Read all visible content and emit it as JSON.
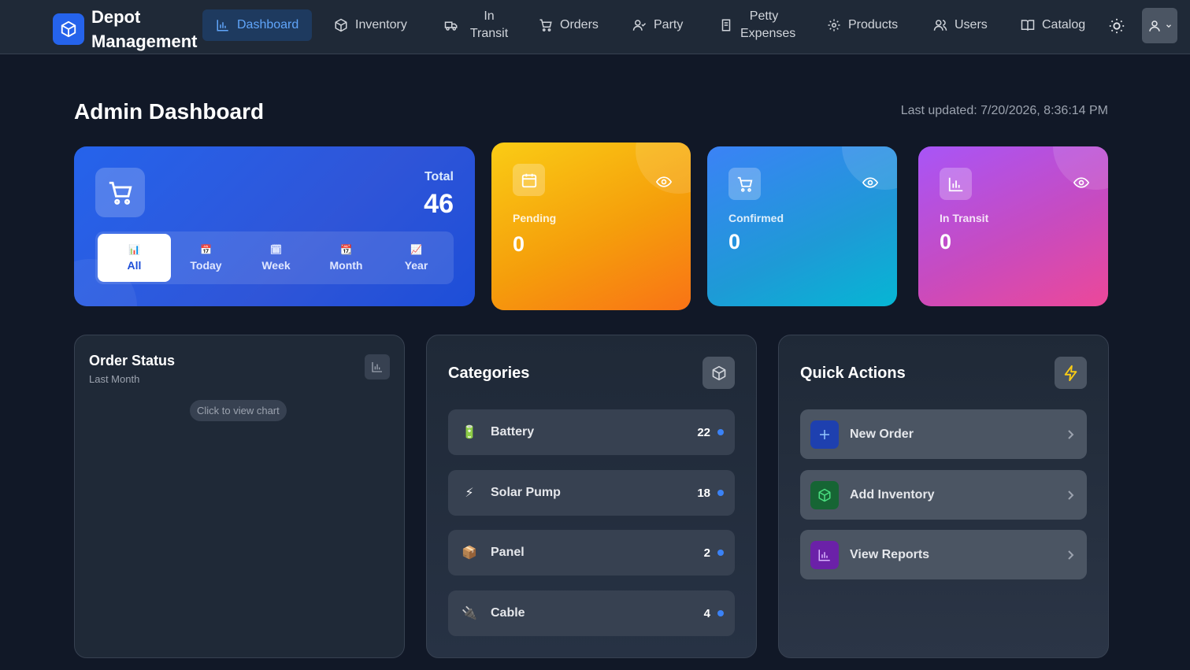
{
  "brand": {
    "title": "Depot Management"
  },
  "nav": {
    "items": [
      {
        "label": "Dashboard",
        "icon": "bar-chart-icon",
        "active": true
      },
      {
        "label": "Inventory",
        "icon": "box-icon"
      },
      {
        "label": "In Transit",
        "icon": "truck-icon"
      },
      {
        "label": "Orders",
        "icon": "cart-icon"
      },
      {
        "label": "Party",
        "icon": "user-check-icon"
      },
      {
        "label": "Petty Expenses",
        "icon": "receipt-icon"
      },
      {
        "label": "Products",
        "icon": "gear-icon"
      },
      {
        "label": "Users",
        "icon": "users-icon"
      },
      {
        "label": "Catalog",
        "icon": "book-icon"
      }
    ]
  },
  "header": {
    "title": "Admin Dashboard",
    "last_updated": "Last updated: 7/20/2026, 8:36:14 PM"
  },
  "stats": {
    "total": {
      "label": "Total",
      "value": "46",
      "periods": [
        {
          "label": "All",
          "icon": "📊",
          "active": true
        },
        {
          "label": "Today",
          "icon": "📅"
        },
        {
          "label": "Week",
          "icon": "🗓"
        },
        {
          "label": "Month",
          "icon": "📆"
        },
        {
          "label": "Year",
          "icon": "📈"
        }
      ]
    },
    "pending": {
      "label": "Pending",
      "value": "0"
    },
    "confirmed": {
      "label": "Confirmed",
      "value": "0"
    },
    "in_transit": {
      "label": "In Transit",
      "value": "0"
    }
  },
  "order_status": {
    "title": "Order Status",
    "subtitle": "Last Month",
    "chart_hint": "Click to view chart"
  },
  "categories": {
    "title": "Categories",
    "items": [
      {
        "name": "Battery",
        "count": "22",
        "emoji": "🔋"
      },
      {
        "name": "Solar Pump",
        "count": "18",
        "emoji": "⚡"
      },
      {
        "name": "Panel",
        "count": "2",
        "emoji": "📦"
      },
      {
        "name": "Cable",
        "count": "4",
        "emoji": "🔌"
      }
    ]
  },
  "quick_actions": {
    "title": "Quick Actions",
    "items": [
      {
        "label": "New Order",
        "icon": "plus-icon",
        "color": "#1e40af"
      },
      {
        "label": "Add Inventory",
        "icon": "box-icon",
        "color": "#166534"
      },
      {
        "label": "View Reports",
        "icon": "bar-chart-icon",
        "color": "#6b21a8"
      }
    ]
  },
  "colors": {
    "accent": "#2563eb",
    "background": "#111827",
    "pending": "#f59e0b",
    "confirmed": "#3b82f6",
    "in_transit": "#d946ef"
  }
}
